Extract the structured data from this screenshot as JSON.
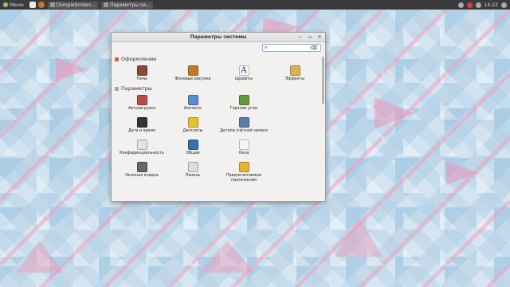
{
  "panel": {
    "menu_label": "Меню",
    "tasks": [
      {
        "label": "[SimpleScreen..."
      },
      {
        "label": "Параметры си..."
      }
    ],
    "clock": "14:22"
  },
  "window": {
    "title": "Параметры системы",
    "search_value": "",
    "sections": [
      {
        "title": "Оформление",
        "items": [
          {
            "label": "Темы",
            "icon": "themes-icon",
            "color": "#8a4a3a"
          },
          {
            "label": "Фоновые рисунки",
            "icon": "backgrounds-icon",
            "color": "#c07a2a"
          },
          {
            "label": "Шрифты",
            "icon": "fonts-icon",
            "color": "#f7f7ff"
          },
          {
            "label": "Эффекты",
            "icon": "effects-icon",
            "color": "#d9b25c"
          }
        ]
      },
      {
        "title": "Параметры",
        "items": [
          {
            "label": "Автозагрузка",
            "icon": "startup-icon",
            "color": "#b84b4b"
          },
          {
            "label": "Апплеты",
            "icon": "applets-icon",
            "color": "#5a8ccf"
          },
          {
            "label": "Горячие углы",
            "icon": "hot-corners-icon",
            "color": "#5f9a3d"
          },
          {
            "label": "",
            "icon": "",
            "color": ""
          },
          {
            "label": "Дата и время",
            "icon": "date-time-icon",
            "color": "#333333"
          },
          {
            "label": "Десклеты",
            "icon": "desklets-icon",
            "color": "#e6c22b"
          },
          {
            "label": "Детали учётной записи",
            "icon": "account-icon",
            "color": "#5a7da8"
          },
          {
            "label": "",
            "icon": "",
            "color": ""
          },
          {
            "label": "Конфиденциальность",
            "icon": "privacy-icon",
            "color": "#e2e2e2"
          },
          {
            "label": "Общие",
            "icon": "general-icon",
            "color": "#3a6fb0"
          },
          {
            "label": "Окна",
            "icon": "windows-icon",
            "color": "#f4f4f4"
          },
          {
            "label": "",
            "icon": "",
            "color": ""
          },
          {
            "label": "Оконная кладка",
            "icon": "tiling-icon",
            "color": "#666666"
          },
          {
            "label": "Панель",
            "icon": "panel-icon",
            "color": "#dddddd"
          },
          {
            "label": "Предпочитаемые приложения",
            "icon": "preferred-apps-icon",
            "color": "#e8b23a"
          }
        ]
      }
    ]
  }
}
